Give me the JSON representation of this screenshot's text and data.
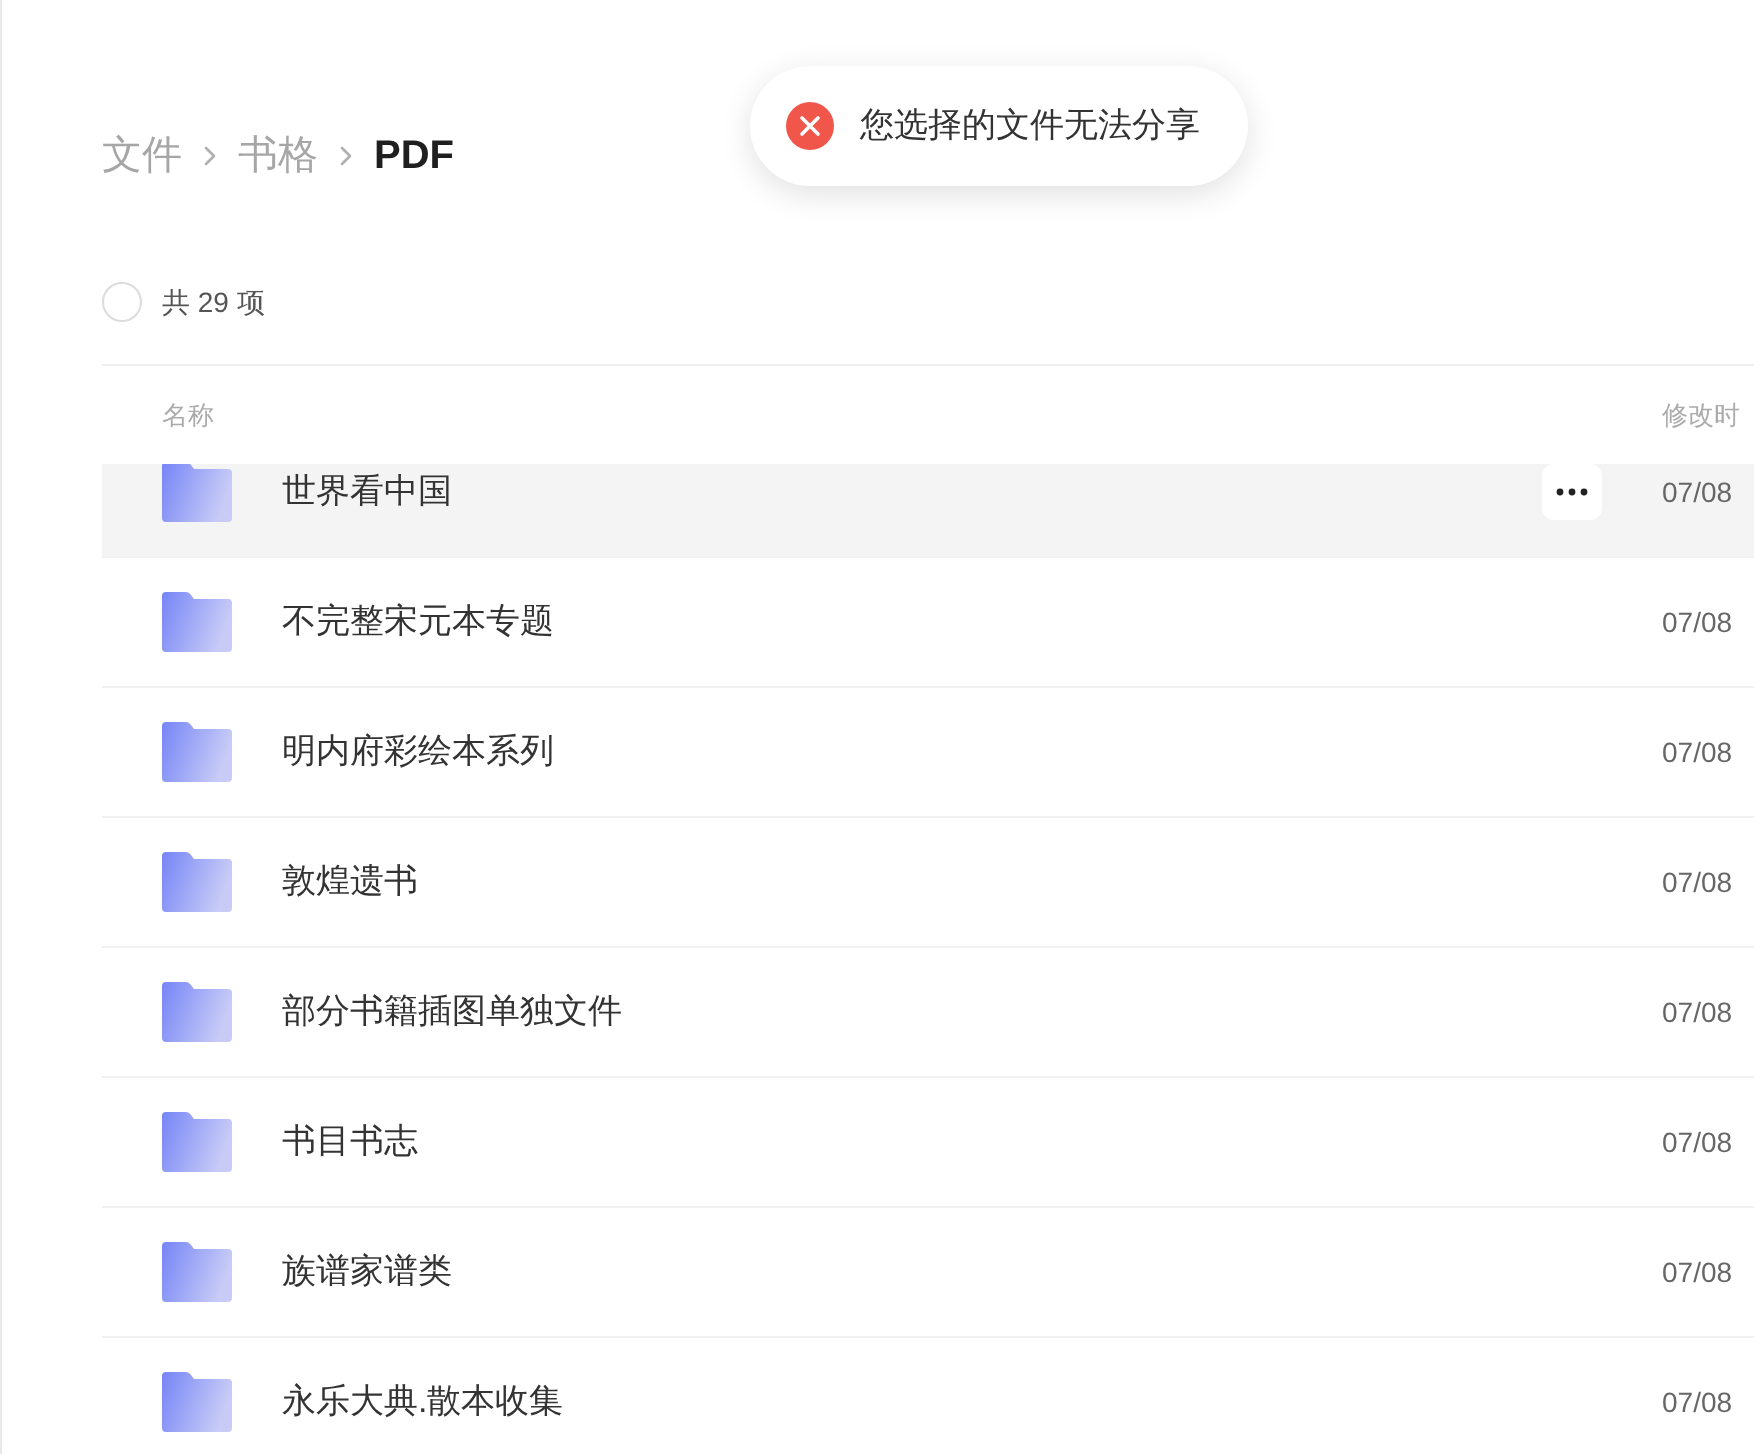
{
  "breadcrumb": [
    {
      "label": "文件",
      "current": false
    },
    {
      "label": "书格",
      "current": false
    },
    {
      "label": "PDF",
      "current": true
    }
  ],
  "toast": {
    "kind": "error",
    "message": "您选择的文件无法分享"
  },
  "select_all": {
    "checked": false,
    "label": "共 29 项"
  },
  "table": {
    "columns": [
      {
        "label": "名称"
      },
      {
        "label": "修改时"
      }
    ],
    "rows": [
      {
        "name": "世界看中国",
        "modified": "07/08",
        "hovered": true
      },
      {
        "name": "不完整宋元本专题",
        "modified": "07/08",
        "hovered": false
      },
      {
        "name": "明内府彩绘本系列",
        "modified": "07/08",
        "hovered": false
      },
      {
        "name": "敦煌遗书",
        "modified": "07/08",
        "hovered": false
      },
      {
        "name": "部分书籍插图单独文件",
        "modified": "07/08",
        "hovered": false
      },
      {
        "name": "书目书志",
        "modified": "07/08",
        "hovered": false
      },
      {
        "name": "族谱家谱类",
        "modified": "07/08",
        "hovered": false
      },
      {
        "name": "永乐大典.散本收集",
        "modified": "07/08",
        "hovered": false
      }
    ]
  }
}
